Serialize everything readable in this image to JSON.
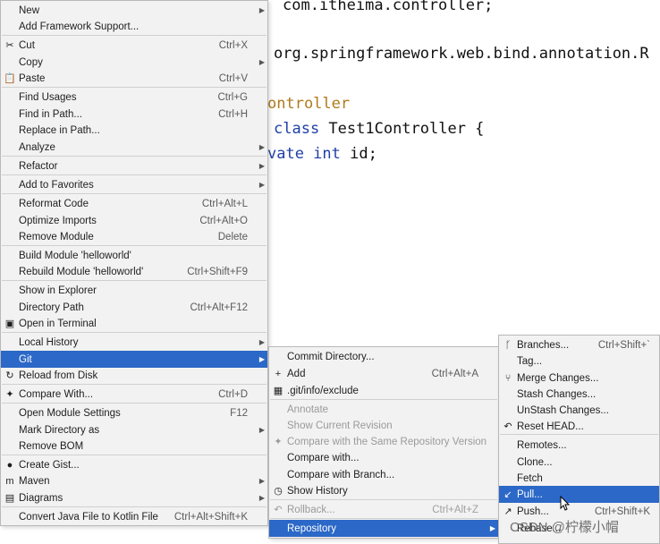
{
  "editor": {
    "lines": [
      {
        "a": "",
        "kw": "",
        "b": "com.itheima.controller;"
      },
      {
        "a": "",
        "kw": "",
        "b": "org.springframework.web.bind.annotation.R"
      },
      {
        "a": "",
        "kw": "",
        "b": "ontroller"
      },
      {
        "a": "",
        "kw": "class",
        "b": " Test1Controller {"
      },
      {
        "a": "",
        "kw": "vate int",
        "b": " id;"
      }
    ]
  },
  "context_menu": {
    "items": [
      {
        "label": "New",
        "shortcut": "",
        "submenu": true,
        "icon": ""
      },
      {
        "label": "Add Framework Support...",
        "shortcut": "",
        "submenu": false,
        "icon": ""
      },
      {
        "label": "Cut",
        "shortcut": "Ctrl+X",
        "submenu": false,
        "icon": "✂"
      },
      {
        "label": "Copy",
        "shortcut": "",
        "submenu": true,
        "icon": ""
      },
      {
        "label": "Paste",
        "shortcut": "Ctrl+V",
        "submenu": false,
        "icon": "📋"
      },
      {
        "label": "Find Usages",
        "shortcut": "Ctrl+G",
        "submenu": false,
        "icon": ""
      },
      {
        "label": "Find in Path...",
        "shortcut": "Ctrl+H",
        "submenu": false,
        "icon": ""
      },
      {
        "label": "Replace in Path...",
        "shortcut": "",
        "submenu": false,
        "icon": ""
      },
      {
        "label": "Analyze",
        "shortcut": "",
        "submenu": true,
        "icon": ""
      },
      {
        "label": "Refactor",
        "shortcut": "",
        "submenu": true,
        "icon": ""
      },
      {
        "label": "Add to Favorites",
        "shortcut": "",
        "submenu": true,
        "icon": ""
      },
      {
        "label": "Reformat Code",
        "shortcut": "Ctrl+Alt+L",
        "submenu": false,
        "icon": ""
      },
      {
        "label": "Optimize Imports",
        "shortcut": "Ctrl+Alt+O",
        "submenu": false,
        "icon": ""
      },
      {
        "label": "Remove Module",
        "shortcut": "Delete",
        "submenu": false,
        "icon": ""
      },
      {
        "label": "Build Module 'helloworld'",
        "shortcut": "",
        "submenu": false,
        "icon": ""
      },
      {
        "label": "Rebuild Module 'helloworld'",
        "shortcut": "Ctrl+Shift+F9",
        "submenu": false,
        "icon": ""
      },
      {
        "label": "Show in Explorer",
        "shortcut": "",
        "submenu": false,
        "icon": ""
      },
      {
        "label": "Directory Path",
        "shortcut": "Ctrl+Alt+F12",
        "submenu": false,
        "icon": ""
      },
      {
        "label": "Open in Terminal",
        "shortcut": "",
        "submenu": false,
        "icon": "▣"
      },
      {
        "label": "Local History",
        "shortcut": "",
        "submenu": true,
        "icon": ""
      },
      {
        "label": "Git",
        "shortcut": "",
        "submenu": true,
        "icon": ""
      },
      {
        "label": "Reload from Disk",
        "shortcut": "",
        "submenu": false,
        "icon": "↻"
      },
      {
        "label": "Compare With...",
        "shortcut": "Ctrl+D",
        "submenu": false,
        "icon": "✦"
      },
      {
        "label": "Open Module Settings",
        "shortcut": "F12",
        "submenu": false,
        "icon": ""
      },
      {
        "label": "Mark Directory as",
        "shortcut": "",
        "submenu": true,
        "icon": ""
      },
      {
        "label": "Remove BOM",
        "shortcut": "",
        "submenu": false,
        "icon": ""
      },
      {
        "label": "Create Gist...",
        "shortcut": "",
        "submenu": false,
        "icon": "●"
      },
      {
        "label": "Maven",
        "shortcut": "",
        "submenu": true,
        "icon": "m"
      },
      {
        "label": "Diagrams",
        "shortcut": "",
        "submenu": true,
        "icon": "▤"
      },
      {
        "label": "Convert Java File to Kotlin File",
        "shortcut": "Ctrl+Alt+Shift+K",
        "submenu": false,
        "icon": ""
      }
    ]
  },
  "git_menu": {
    "items": [
      {
        "label": "Commit Directory...",
        "shortcut": "",
        "submenu": false,
        "icon": "",
        "disabled": false
      },
      {
        "label": "Add",
        "shortcut": "Ctrl+Alt+A",
        "submenu": false,
        "icon": "+",
        "disabled": false
      },
      {
        "label": ".git/info/exclude",
        "shortcut": "",
        "submenu": false,
        "icon": "▦",
        "disabled": false
      },
      {
        "label": "Annotate",
        "shortcut": "",
        "submenu": false,
        "icon": "",
        "disabled": true
      },
      {
        "label": "Show Current Revision",
        "shortcut": "",
        "submenu": false,
        "icon": "",
        "disabled": true
      },
      {
        "label": "Compare with the Same Repository Version",
        "shortcut": "",
        "submenu": false,
        "icon": "✦",
        "disabled": true
      },
      {
        "label": "Compare with...",
        "shortcut": "",
        "submenu": false,
        "icon": "",
        "disabled": false
      },
      {
        "label": "Compare with Branch...",
        "shortcut": "",
        "submenu": false,
        "icon": "",
        "disabled": false
      },
      {
        "label": "Show History",
        "shortcut": "",
        "submenu": false,
        "icon": "◷",
        "disabled": false
      },
      {
        "label": "Rollback...",
        "shortcut": "Ctrl+Alt+Z",
        "submenu": false,
        "icon": "↶",
        "disabled": true
      },
      {
        "label": "Repository",
        "shortcut": "",
        "submenu": true,
        "icon": "",
        "disabled": false
      }
    ]
  },
  "repo_menu": {
    "items": [
      {
        "label": "Branches...",
        "shortcut": "Ctrl+Shift+`",
        "icon": "ᚴ"
      },
      {
        "label": "Tag...",
        "shortcut": "",
        "icon": ""
      },
      {
        "label": "Merge Changes...",
        "shortcut": "",
        "icon": "⑂"
      },
      {
        "label": "Stash Changes...",
        "shortcut": "",
        "icon": ""
      },
      {
        "label": "UnStash Changes...",
        "shortcut": "",
        "icon": ""
      },
      {
        "label": "Reset HEAD...",
        "shortcut": "",
        "icon": "↶"
      },
      {
        "label": "Remotes...",
        "shortcut": "",
        "icon": ""
      },
      {
        "label": "Clone...",
        "shortcut": "",
        "icon": ""
      },
      {
        "label": "Fetch",
        "shortcut": "",
        "icon": ""
      },
      {
        "label": "Pull...",
        "shortcut": "",
        "icon": "↙"
      },
      {
        "label": "Push...",
        "shortcut": "Ctrl+Shift+K",
        "icon": "↗"
      },
      {
        "label": "Rebase...",
        "shortcut": "",
        "icon": ""
      }
    ]
  },
  "watermark": "CSDN @柠檬小帽",
  "colors": {
    "selection": "#2b68c7",
    "menu_bg": "#f2f2f2",
    "keyword": "#1f3fa8"
  }
}
